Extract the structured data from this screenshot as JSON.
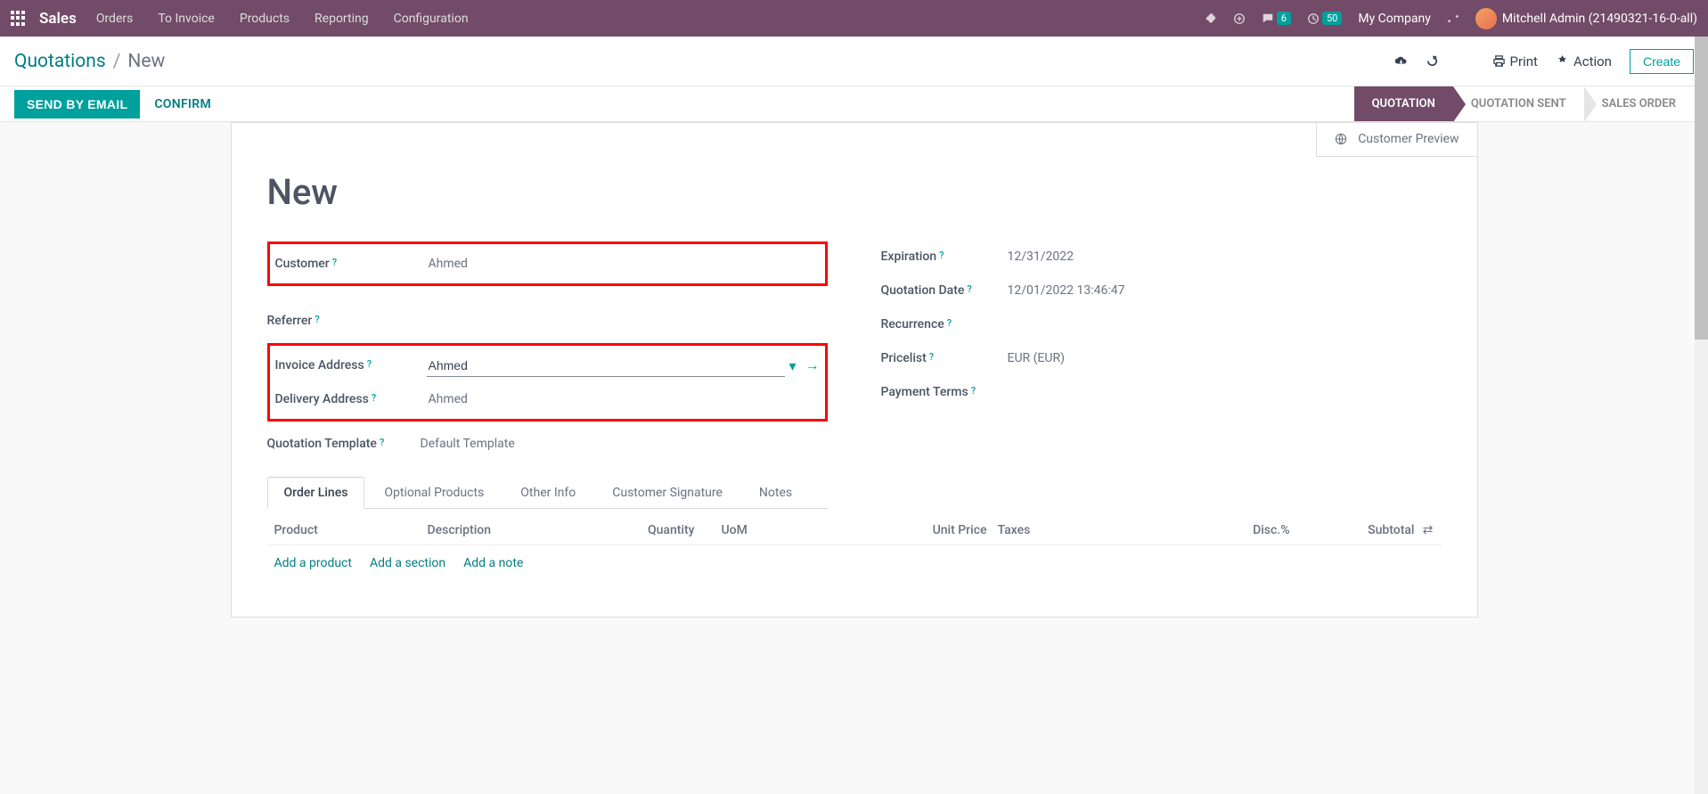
{
  "nav": {
    "title": "Sales",
    "items": [
      "Orders",
      "To Invoice",
      "Products",
      "Reporting",
      "Configuration"
    ],
    "chat_badge": "6",
    "clock_badge": "50",
    "company": "My Company",
    "user": "Mitchell Admin (21490321-16-0-all)"
  },
  "crumb": {
    "root": "Quotations",
    "current": "New",
    "print": "Print",
    "action": "Action",
    "create": "Create"
  },
  "actions": {
    "send": "SEND BY EMAIL",
    "confirm": "CONFIRM"
  },
  "statuses": [
    "QUOTATION",
    "QUOTATION SENT",
    "SALES ORDER"
  ],
  "cust_preview": "Customer Preview",
  "title": "New",
  "form": {
    "customer_label": "Customer",
    "customer_value": "Ahmed",
    "referrer_label": "Referrer",
    "invoice_addr_label": "Invoice Address",
    "invoice_addr_value": "Ahmed",
    "delivery_addr_label": "Delivery Address",
    "delivery_addr_value": "Ahmed",
    "template_label": "Quotation Template",
    "template_value": "Default Template",
    "expiration_label": "Expiration",
    "expiration_value": "12/31/2022",
    "qdate_label": "Quotation Date",
    "qdate_value": "12/01/2022 13:46:47",
    "recurrence_label": "Recurrence",
    "pricelist_label": "Pricelist",
    "pricelist_value": "EUR (EUR)",
    "payment_label": "Payment Terms"
  },
  "tabs": [
    "Order Lines",
    "Optional Products",
    "Other Info",
    "Customer Signature",
    "Notes"
  ],
  "table": {
    "headers": {
      "product": "Product",
      "desc": "Description",
      "qty": "Quantity",
      "uom": "UoM",
      "price": "Unit Price",
      "taxes": "Taxes",
      "disc": "Disc.%",
      "subtotal": "Subtotal"
    },
    "actions": [
      "Add a product",
      "Add a section",
      "Add a note"
    ]
  }
}
